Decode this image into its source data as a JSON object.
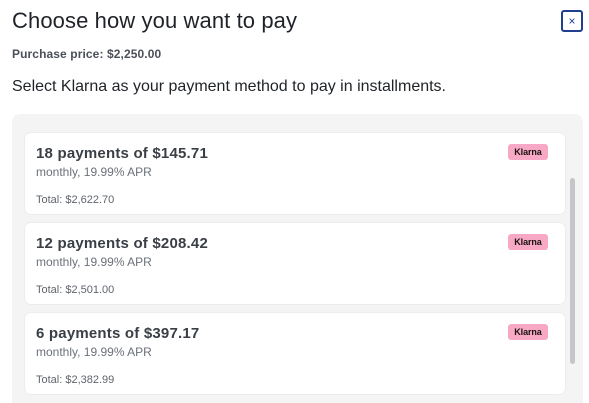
{
  "dialog": {
    "title": "Choose how you want to pay",
    "close_icon": "close-x-icon",
    "purchase_price": "Purchase price: $2,250.00",
    "instructions": "Select Klarna as your payment method to pay in installments."
  },
  "options": [
    {
      "heading": "18 payments of $145.71",
      "terms": "monthly, 19.99% APR",
      "total": "Total: $2,622.70",
      "badge": "Klarna"
    },
    {
      "heading": "12 payments of $208.42",
      "terms": "monthly, 19.99% APR",
      "total": "Total: $2,501.00",
      "badge": "Klarna"
    },
    {
      "heading": "6 payments of $397.17",
      "terms": "monthly, 19.99% APR",
      "total": "Total: $2,382.99",
      "badge": "Klarna"
    }
  ],
  "colors": {
    "klarna_pink": "#f7a8c4",
    "close_border": "#1f3f8f",
    "panel_bg": "#f4f4f5"
  }
}
